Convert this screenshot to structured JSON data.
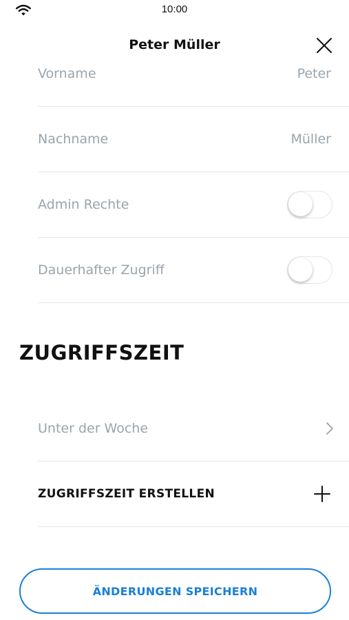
{
  "status_bar": {
    "time": "10:00",
    "wifi_icon": "wifi-icon"
  },
  "header": {
    "title": "Peter Müller",
    "close_icon": "close-icon"
  },
  "fields": {
    "first_name": {
      "label": "Vorname",
      "value": "Peter"
    },
    "last_name": {
      "label": "Nachname",
      "value": "Müller"
    },
    "admin": {
      "label": "Admin Rechte",
      "enabled": false
    },
    "permanent_access": {
      "label": "Dauerhafter Zugriff",
      "enabled": false
    }
  },
  "access_section": {
    "title": "ZUGRIFFSZEIT",
    "items": [
      {
        "label": "Unter der Woche",
        "icon": "chevron-right-icon"
      }
    ],
    "create_label": "ZUGRIFFSZEIT ERSTELLEN",
    "create_icon": "plus-icon"
  },
  "footer": {
    "save_label": "ÄNDERUNGEN SPEICHERN"
  },
  "colors": {
    "accent": "#1a7fd6",
    "muted_text": "#9aa4ad",
    "divider": "#e3e5e8"
  }
}
